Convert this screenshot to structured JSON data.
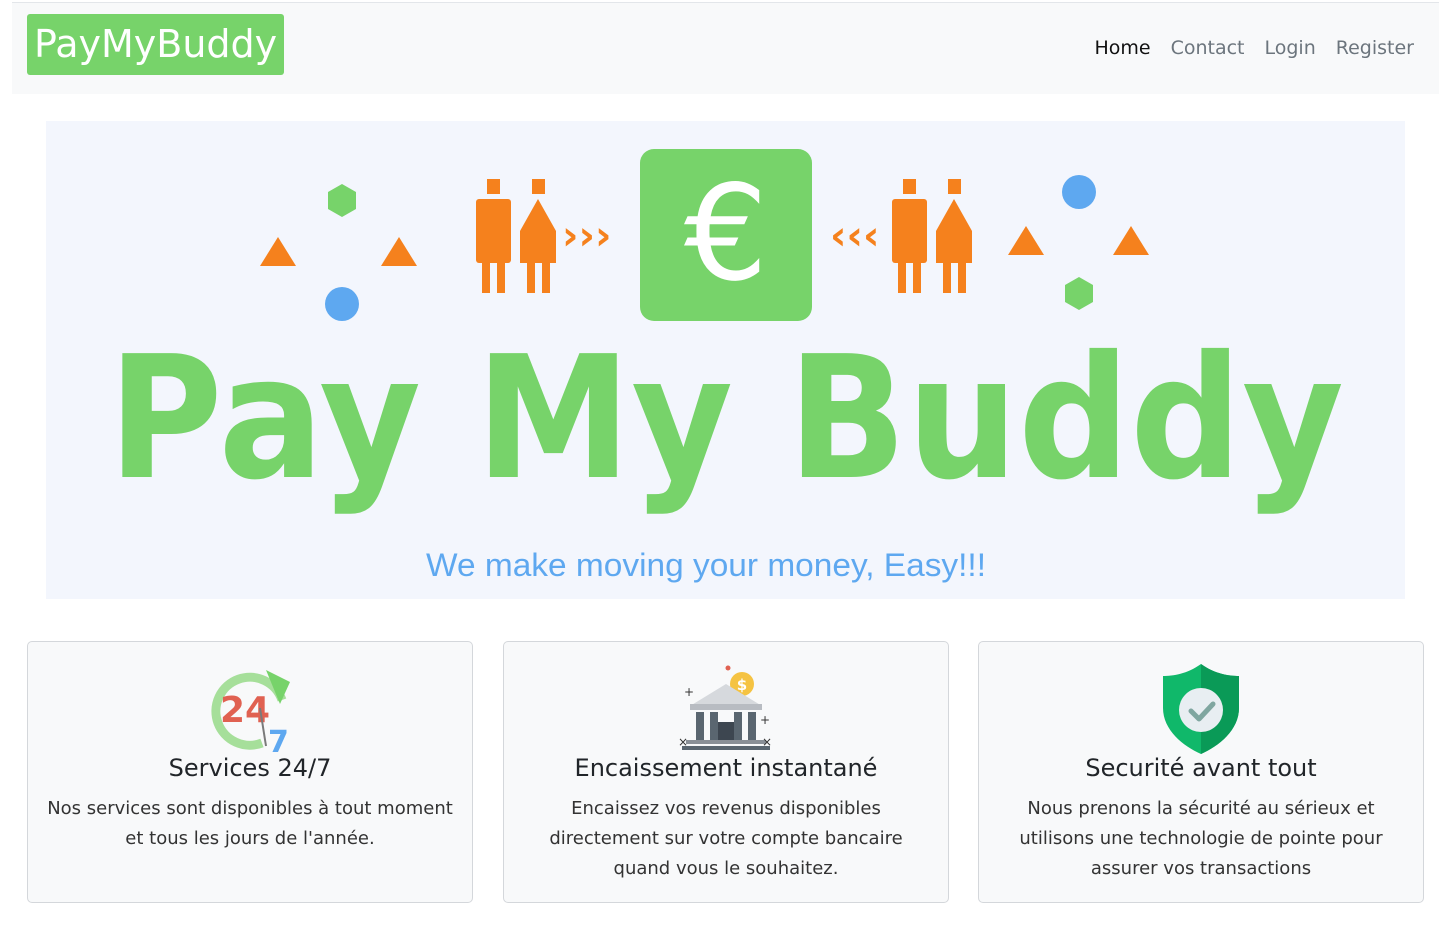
{
  "navbar": {
    "brand": "PayMyBuddy",
    "links": [
      {
        "label": "Home",
        "active": true
      },
      {
        "label": "Contact",
        "active": false
      },
      {
        "label": "Login",
        "active": false
      },
      {
        "label": "Register",
        "active": false
      }
    ]
  },
  "hero": {
    "logo_text": "Pay My Buddy",
    "tagline": "We make moving your money, Easy!!!",
    "currency_symbol": "€",
    "colors": {
      "green": "#77d36a",
      "orange": "#f5811d",
      "blue": "#5ea8f0",
      "tagline": "#5ea8f0"
    }
  },
  "cards": [
    {
      "icon": "clock-24-7-icon",
      "title": "Services 24/7",
      "text": "Nos services sont disponibles à tout moment et tous les jours de l'année."
    },
    {
      "icon": "bank-icon",
      "title": "Encaissement instantané",
      "text": "Encaissez vos revenus disponibles directement sur votre compte bancaire quand vous le souhaitez."
    },
    {
      "icon": "shield-check-icon",
      "title": "Securité avant tout",
      "text": "Nous prenons la sécurité au sérieux et utilisons une technologie de pointe pour assurer vos transactions"
    }
  ]
}
